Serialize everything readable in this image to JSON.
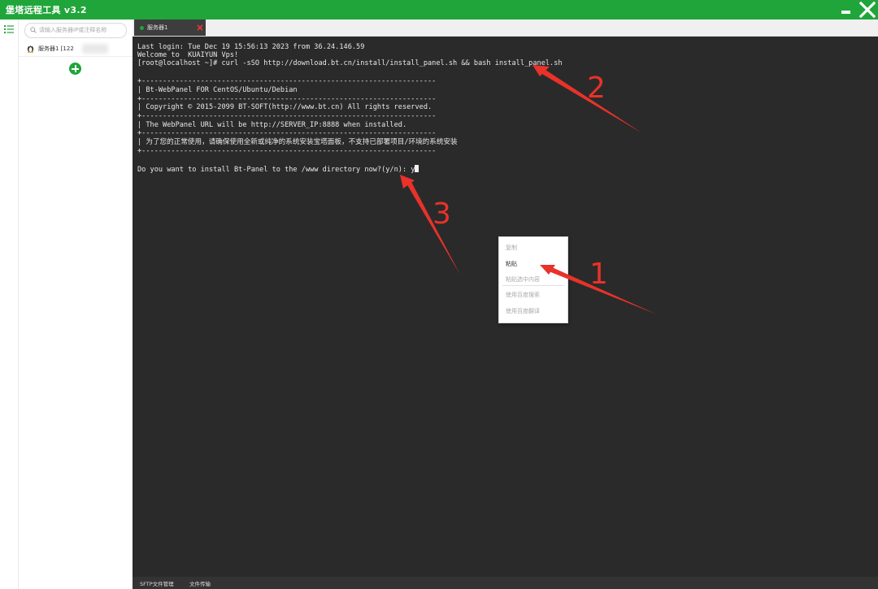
{
  "app": {
    "title": "堡塔远程工具 v3.2"
  },
  "colors": {
    "brand": "#20a53a",
    "terminal_bg": "#2a2a2a",
    "annotation": "#e8322a"
  },
  "sidebar": {
    "search_placeholder": "请输入服务器IP或注释名称",
    "servers": [
      {
        "name": "服务器1 [122",
        "icon": "linux-penguin-icon"
      }
    ]
  },
  "tabs": [
    {
      "label": "服务器1",
      "status": "connected"
    }
  ],
  "terminal": {
    "lines": [
      "Last login: Tue Dec 19 15:56:13 2023 from 36.24.146.59",
      "Welcome to  KUAIYUN Vps!",
      "[root@localhost ~]# curl -sSO http://download.bt.cn/install/install_panel.sh && bash install_panel.sh",
      "",
      "+----------------------------------------------------------------------",
      "| Bt-WebPanel FOR CentOS/Ubuntu/Debian",
      "+----------------------------------------------------------------------",
      "| Copyright © 2015-2099 BT-SOFT(http://www.bt.cn) All rights reserved.",
      "+----------------------------------------------------------------------",
      "| The WebPanel URL will be http://SERVER_IP:8888 when installed.",
      "+----------------------------------------------------------------------",
      "| 为了您的正常使用，请确保使用全新或纯净的系统安装宝塔面板，不支持已部署项目/环境的系统安装",
      "+----------------------------------------------------------------------",
      "",
      "Do you want to install Bt-Panel to the /www directory now?(y/n): y"
    ]
  },
  "context_menu": {
    "items": [
      {
        "label": "复制",
        "enabled": false
      },
      {
        "label": "粘贴",
        "enabled": true
      },
      {
        "label": "粘贴选中内容",
        "enabled": false
      },
      {
        "label": "使用百度搜索",
        "enabled": false
      },
      {
        "label": "使用百度翻译",
        "enabled": false
      }
    ]
  },
  "bottom_tabs": [
    "SFTP文件管理",
    "文件传输"
  ],
  "annotations": [
    "2",
    "3",
    "1"
  ]
}
